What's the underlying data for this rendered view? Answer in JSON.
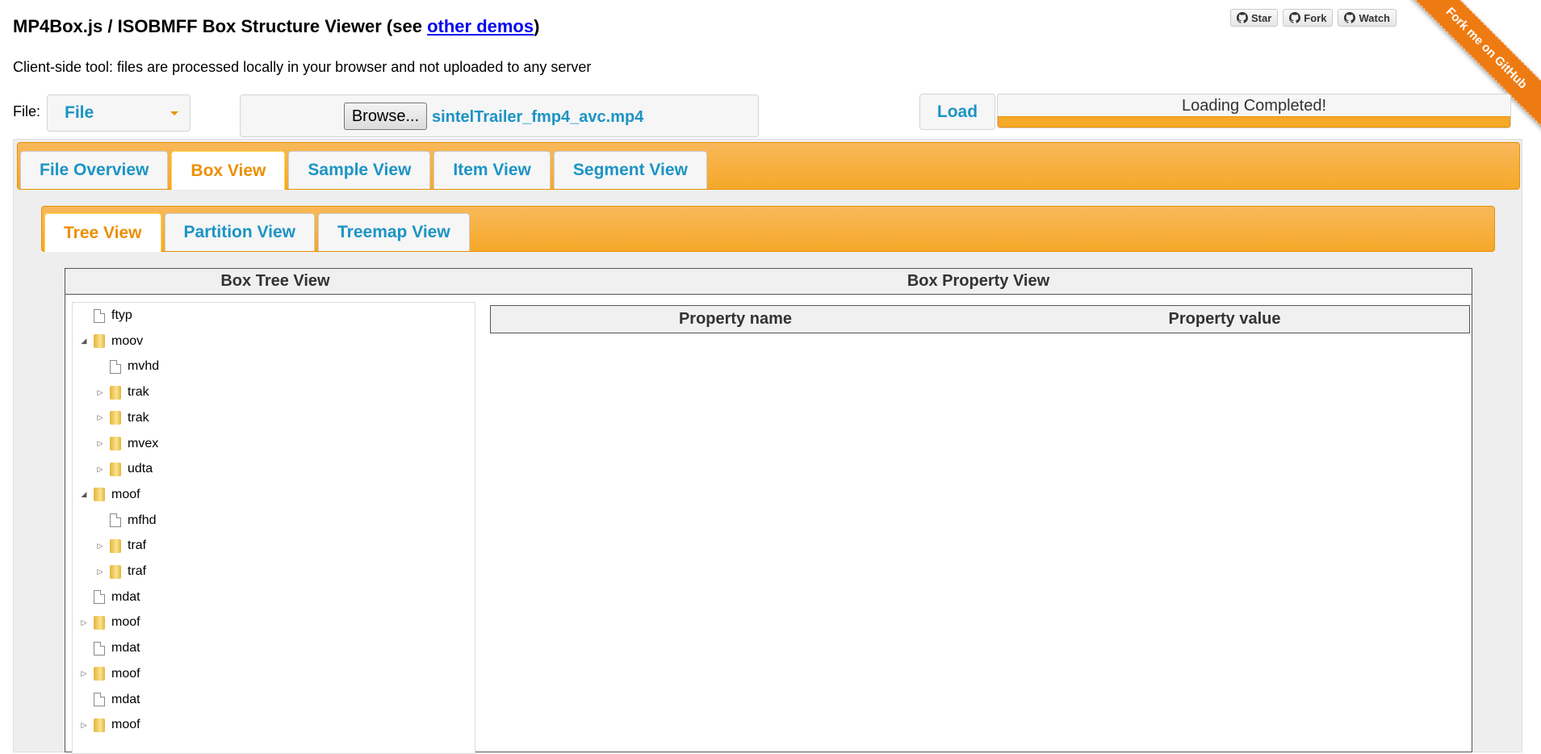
{
  "header": {
    "title_prefix": "MP4Box.js / ISOBMFF Box Structure Viewer (see ",
    "title_link": "other demos",
    "title_suffix": ")",
    "subtitle": "Client-side tool: files are processed locally in your browser and not uploaded to any server"
  },
  "github": {
    "star": "Star",
    "fork": "Fork",
    "watch": "Watch",
    "ribbon": "Fork me on GitHub"
  },
  "file_row": {
    "label": "File:",
    "select_value": "File",
    "browse_label": "Browse...",
    "file_name": "sintelTrailer_fmp4_avc.mp4",
    "load_label": "Load",
    "progress_text": "Loading Completed!",
    "progress_fraction": 1.0
  },
  "main_tabs": [
    {
      "label": "File Overview",
      "active": false
    },
    {
      "label": "Box View",
      "active": true
    },
    {
      "label": "Sample View",
      "active": false
    },
    {
      "label": "Item View",
      "active": false
    },
    {
      "label": "Segment View",
      "active": false
    }
  ],
  "sub_tabs": [
    {
      "label": "Tree View",
      "active": true
    },
    {
      "label": "Partition View",
      "active": false
    },
    {
      "label": "Treemap View",
      "active": false
    }
  ],
  "box_tree": {
    "heading": "Box Tree View",
    "nodes": [
      {
        "name": "ftyp",
        "level": 0,
        "type": "file",
        "toggle": "none"
      },
      {
        "name": "moov",
        "level": 0,
        "type": "folder",
        "toggle": "open"
      },
      {
        "name": "mvhd",
        "level": 1,
        "type": "file",
        "toggle": "none"
      },
      {
        "name": "trak",
        "level": 1,
        "type": "folder",
        "toggle": "closed"
      },
      {
        "name": "trak",
        "level": 1,
        "type": "folder",
        "toggle": "closed"
      },
      {
        "name": "mvex",
        "level": 1,
        "type": "folder",
        "toggle": "closed"
      },
      {
        "name": "udta",
        "level": 1,
        "type": "folder",
        "toggle": "closed"
      },
      {
        "name": "moof",
        "level": 0,
        "type": "folder",
        "toggle": "open"
      },
      {
        "name": "mfhd",
        "level": 1,
        "type": "file",
        "toggle": "none"
      },
      {
        "name": "traf",
        "level": 1,
        "type": "folder",
        "toggle": "closed"
      },
      {
        "name": "traf",
        "level": 1,
        "type": "folder",
        "toggle": "closed"
      },
      {
        "name": "mdat",
        "level": 0,
        "type": "file",
        "toggle": "none"
      },
      {
        "name": "moof",
        "level": 0,
        "type": "folder",
        "toggle": "closed"
      },
      {
        "name": "mdat",
        "level": 0,
        "type": "file",
        "toggle": "none"
      },
      {
        "name": "moof",
        "level": 0,
        "type": "folder",
        "toggle": "closed"
      },
      {
        "name": "mdat",
        "level": 0,
        "type": "file",
        "toggle": "none"
      },
      {
        "name": "moof",
        "level": 0,
        "type": "folder",
        "toggle": "closed"
      }
    ]
  },
  "box_property": {
    "heading": "Box Property View",
    "col_name": "Property name",
    "col_value": "Property value"
  },
  "colors": {
    "accent_orange": "#f6a828",
    "link_blue": "#1c94c4",
    "active_tab_text": "#eb8f00"
  }
}
